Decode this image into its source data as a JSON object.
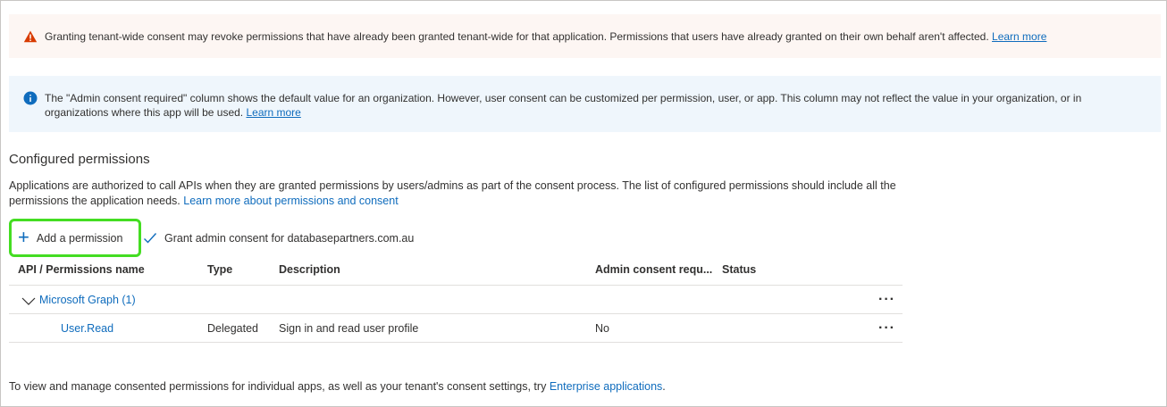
{
  "warning_banner": {
    "text": "Granting tenant-wide consent may revoke permissions that have already been granted tenant-wide for that application. Permissions that users have already granted on their own behalf aren't affected.",
    "link": "Learn more",
    "icon": "warning-icon"
  },
  "info_banner": {
    "text": "The \"Admin consent required\" column shows the default value for an organization. However, user consent can be customized per permission, user, or app. This column may not reflect the value in your organization, or in organizations where this app will be used.",
    "link": "Learn more",
    "icon": "info-icon"
  },
  "section": {
    "title": "Configured permissions",
    "description": "Applications are authorized to call APIs when they are granted permissions by users/admins as part of the consent process. The list of configured permissions should include all the permissions the application needs.",
    "link": "Learn more about permissions and consent"
  },
  "toolbar": {
    "add_label": "Add a permission",
    "grant_label": "Grant admin consent for databasepartners.com.au"
  },
  "table": {
    "columns": [
      "API / Permissions name",
      "Type",
      "Description",
      "Admin consent requ...",
      "Status"
    ],
    "groups": [
      {
        "label": "Microsoft Graph (1)",
        "rows": [
          {
            "name": "User.Read",
            "type": "Delegated",
            "description": "Sign in and read user profile",
            "admin_consent": "No",
            "status": ""
          }
        ]
      }
    ],
    "more_label": "···"
  },
  "footer": {
    "text": "To view and manage consented permissions for individual apps, as well as your tenant's consent settings, try",
    "link": "Enterprise applications",
    "suffix": "."
  },
  "colors": {
    "accent": "#0f6cbd",
    "warning_bg": "#fdf6f3",
    "info_bg": "#eff6fc",
    "highlight": "#44dd22",
    "warning_icon": "#d83b01"
  }
}
